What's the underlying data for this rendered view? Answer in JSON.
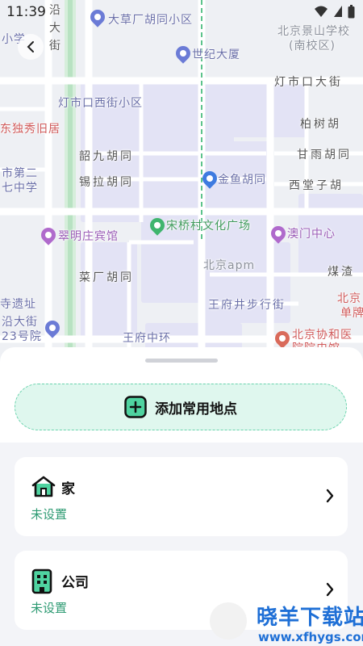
{
  "status_bar": {
    "time": "11:39"
  },
  "map": {
    "labels": {
      "dacaochang": "大草厂胡同小区",
      "yan": "沿",
      "da": "大",
      "jie": "街",
      "jingshan": "北京景山学校",
      "jingshan_sub": "(南校区)",
      "shiji": "世纪大厦",
      "dengshikou_da": "灯市口大街",
      "dengshikou_xi": "灯市口西街小区",
      "baishu": "柏树胡",
      "duxiu": "东独秀旧居",
      "ganyu": "甘雨胡同",
      "shaojiu": "韶九胡同",
      "xila": "锡拉胡同",
      "jinyu": "金鱼胡同",
      "xitangzi": "西堂子胡",
      "shidier": "市第二",
      "qizhong": "七中学",
      "songqiaocun": "宋桥村文化广场",
      "cuiming": "翠明庄宾馆",
      "aomen": "澳门中心",
      "beijing_apm": "北京apm",
      "meizha": "煤渣",
      "caichang": "菜厂胡同",
      "wangfujing_bxj": "王府井步行街",
      "yizhi": "寺遗址",
      "yandajie": "沿大街",
      "hao23": "23号院",
      "wangfu_zhonghuan": "王府中环",
      "xiehe": "北京协和医",
      "xiehe2": "院院史馆",
      "xiaoxue": "小学",
      "beijing_dan": "北京",
      "danpai": "单牌"
    }
  },
  "sheet": {
    "add_button_label": "添加常用地点",
    "places": [
      {
        "title": "家",
        "status": "未设置",
        "icon": "home-icon"
      },
      {
        "title": "公司",
        "status": "未设置",
        "icon": "office-building-icon"
      }
    ]
  },
  "watermark": {
    "title": "晓羊下载站",
    "url": "www.xfhygs.com"
  },
  "colors": {
    "accent": "#2e9b73",
    "accent_bg": "#dff7ee",
    "map_bg": "#eef0f4"
  }
}
